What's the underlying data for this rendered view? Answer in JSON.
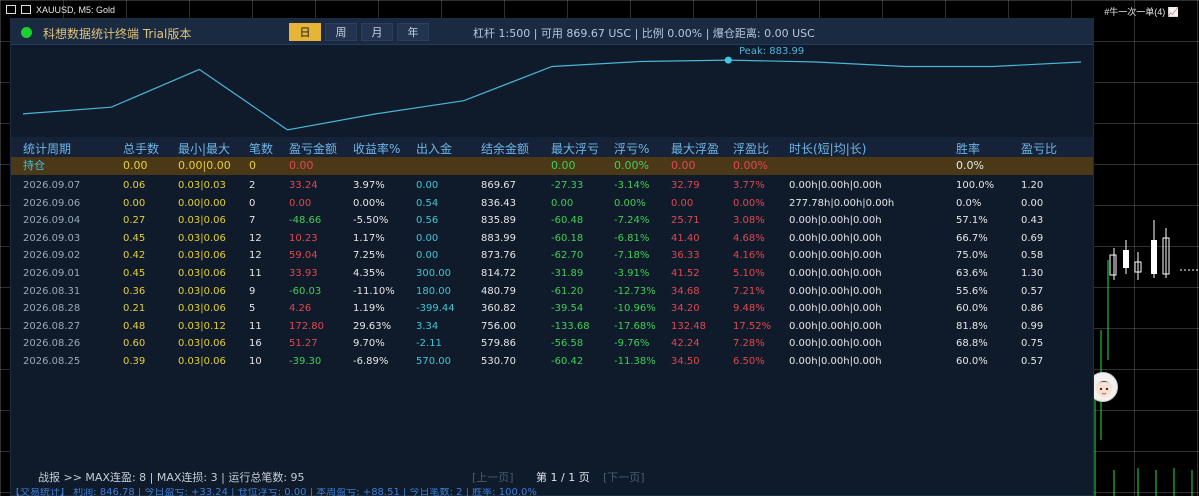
{
  "window": {
    "symbol_title": "XAUUSD, M5: Gold",
    "right_label": "#牛一次一单(4) 📈"
  },
  "header": {
    "title": "科想数据统计终端 Trial版本",
    "periods": [
      "日",
      "周",
      "月",
      "年"
    ],
    "active_period": "日",
    "account_info": "杠杆 1:500 | 可用 869.67 USC | 比例 0.00% | 爆仓距离: 0.00 USC"
  },
  "equity_curve": {
    "peak_label": "Peak: 883.99",
    "values": [
      480.79,
      530.7,
      814.72,
      360.82,
      480.79,
      579.86,
      836.43,
      873.76,
      883.99,
      869.67,
      835.89,
      836.43,
      869.67
    ]
  },
  "table": {
    "columns": [
      "统计周期",
      "总手数",
      "最小|最大",
      "笔数",
      "盈亏金额",
      "收益率%",
      "出入金",
      "结余金额",
      "最大浮亏",
      "浮亏%",
      "最大浮盈",
      "浮盈比",
      "时长(短|均|长)",
      "胜率",
      "盈亏比"
    ],
    "holding": [
      "持仓",
      "0.00",
      "0.00|0.00",
      "0",
      "0.00",
      "",
      "",
      "",
      "0.00",
      "0.00%",
      "0.00",
      "0.00%",
      "",
      "0.0%",
      ""
    ],
    "rows": [
      [
        "2026.09.07",
        "0.06",
        "0.03|0.03",
        "2",
        "33.24",
        "3.97%",
        "0.00",
        "869.67",
        "-27.33",
        "-3.14%",
        "32.79",
        "3.77%",
        "0.00h|0.00h|0.00h",
        "100.0%",
        "1.20"
      ],
      [
        "2026.09.06",
        "0.00",
        "0.00|0.00",
        "0",
        "0.00",
        "0.00%",
        "0.54",
        "836.43",
        "0.00",
        "0.00%",
        "0.00",
        "0.00%",
        "277.78h|0.00h|0.00h",
        "0.0%",
        "0.00"
      ],
      [
        "2026.09.04",
        "0.27",
        "0.03|0.06",
        "7",
        "-48.66",
        "-5.50%",
        "0.56",
        "835.89",
        "-60.48",
        "-7.24%",
        "25.71",
        "3.08%",
        "0.00h|0.00h|0.00h",
        "57.1%",
        "0.43"
      ],
      [
        "2026.09.03",
        "0.45",
        "0.03|0.06",
        "12",
        "10.23",
        "1.17%",
        "0.00",
        "883.99",
        "-60.18",
        "-6.81%",
        "41.40",
        "4.68%",
        "0.00h|0.00h|0.00h",
        "66.7%",
        "0.69"
      ],
      [
        "2026.09.02",
        "0.42",
        "0.03|0.06",
        "12",
        "59.04",
        "7.25%",
        "0.00",
        "873.76",
        "-62.70",
        "-7.18%",
        "36.33",
        "4.16%",
        "0.00h|0.00h|0.00h",
        "75.0%",
        "0.58"
      ],
      [
        "2026.09.01",
        "0.45",
        "0.03|0.06",
        "11",
        "33.93",
        "4.35%",
        "300.00",
        "814.72",
        "-31.89",
        "-3.91%",
        "41.52",
        "5.10%",
        "0.00h|0.00h|0.00h",
        "63.6%",
        "1.30"
      ],
      [
        "2026.08.31",
        "0.36",
        "0.03|0.06",
        "9",
        "-60.03",
        "-11.10%",
        "180.00",
        "480.79",
        "-61.20",
        "-12.73%",
        "34.68",
        "7.21%",
        "0.00h|0.00h|0.00h",
        "55.6%",
        "0.57"
      ],
      [
        "2026.08.28",
        "0.21",
        "0.03|0.06",
        "5",
        "4.26",
        "1.19%",
        "-399.44",
        "360.82",
        "-39.54",
        "-10.96%",
        "34.20",
        "9.48%",
        "0.00h|0.00h|0.00h",
        "60.0%",
        "0.86"
      ],
      [
        "2026.08.27",
        "0.48",
        "0.03|0.12",
        "11",
        "172.80",
        "29.63%",
        "3.34",
        "756.00",
        "-133.68",
        "-17.68%",
        "132.48",
        "17.52%",
        "0.00h|0.00h|0.00h",
        "81.8%",
        "0.99"
      ],
      [
        "2026.08.26",
        "0.60",
        "0.03|0.06",
        "16",
        "51.27",
        "9.70%",
        "-2.11",
        "579.86",
        "-56.58",
        "-9.76%",
        "42.24",
        "7.28%",
        "0.00h|0.00h|0.00h",
        "68.8%",
        "0.75"
      ],
      [
        "2026.08.25",
        "0.39",
        "0.03|0.06",
        "10",
        "-39.30",
        "-6.89%",
        "570.00",
        "530.70",
        "-60.42",
        "-11.38%",
        "34.50",
        "6.50%",
        "0.00h|0.00h|0.00h",
        "60.0%",
        "0.57"
      ]
    ]
  },
  "footer": {
    "stats": "战报 >> MAX连盈: 8 | MAX连损: 3 | 运行总笔数: 95",
    "prev": "[上一页]",
    "page": "第 1 / 1 页",
    "next": "[下一页]",
    "status_line": "【交易统计】 利润: 846.78 | 今日盈亏: +33.24 | 仓位浮亏: 0.00 | 本周盈亏: +88.51 | 今日笔数: 2 | 胜率: 100.0%"
  },
  "colors": {
    "panel_bg": "#0f1a2a",
    "accent_gold": "#e6b436",
    "profit_red": "#e0484f",
    "loss_green": "#3fcf56",
    "curve": "#4bb6d6"
  }
}
